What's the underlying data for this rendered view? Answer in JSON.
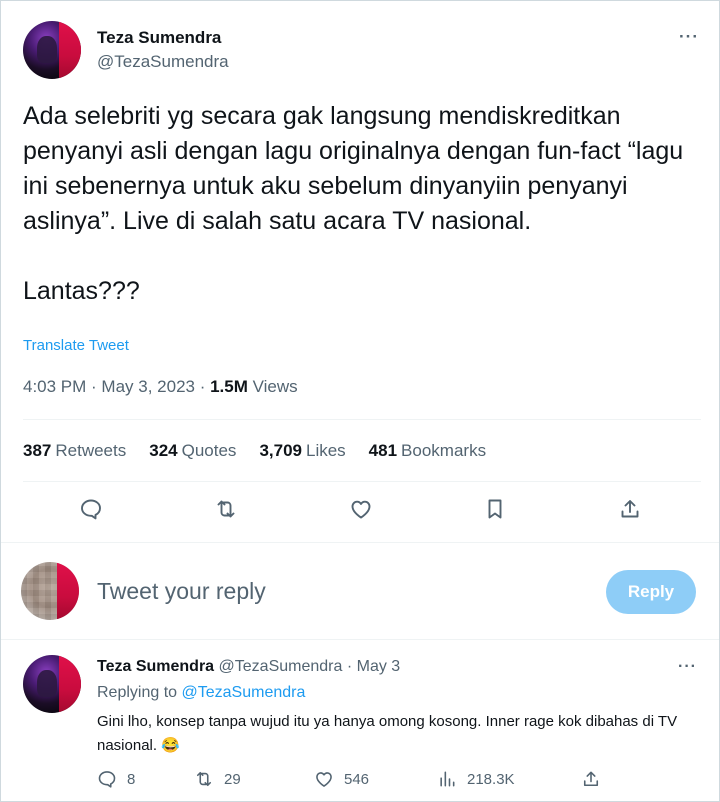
{
  "tweet": {
    "author_name": "Teza Sumendra",
    "author_handle": "@TezaSumendra",
    "more": "···",
    "text": "Ada selebriti yg secara gak langsung mendiskreditkan penyanyi asli dengan lagu originalnya dengan fun-fact “lagu ini sebenernya untuk aku sebelum dinyanyiin penyanyi aslinya”. Live di salah satu acara TV nasional.\n\nLantas???",
    "translate_label": "Translate Tweet",
    "time": "4:03 PM",
    "date": "May 3, 2023",
    "views_count": "1.5M",
    "views_label": "Views"
  },
  "stats": {
    "retweets_count": "387",
    "retweets_label": "Retweets",
    "quotes_count": "324",
    "quotes_label": "Quotes",
    "likes_count": "3,709",
    "likes_label": "Likes",
    "bookmarks_count": "481",
    "bookmarks_label": "Bookmarks"
  },
  "actions": [
    "reply-icon",
    "retweet-icon",
    "like-icon",
    "bookmark-icon",
    "share-icon"
  ],
  "composer": {
    "placeholder": "Tweet your reply",
    "reply_button": "Reply"
  },
  "reply": {
    "author_name": "Teza Sumendra",
    "author_handle": "@TezaSumendra",
    "date": "May 3",
    "more": "···",
    "replying_prefix": "Replying to",
    "replying_handle": "@TezaSumendra",
    "text": "Gini lho, konsep tanpa wujud itu ya hanya omong kosong. Inner rage kok dibahas di TV nasional. 😂",
    "replies": "8",
    "retweets": "29",
    "likes": "546",
    "views": "218.3K"
  },
  "colors": {
    "accent": "#1d9bf0",
    "reply_button_disabled": "#8ecdf7",
    "muted": "#536471"
  }
}
